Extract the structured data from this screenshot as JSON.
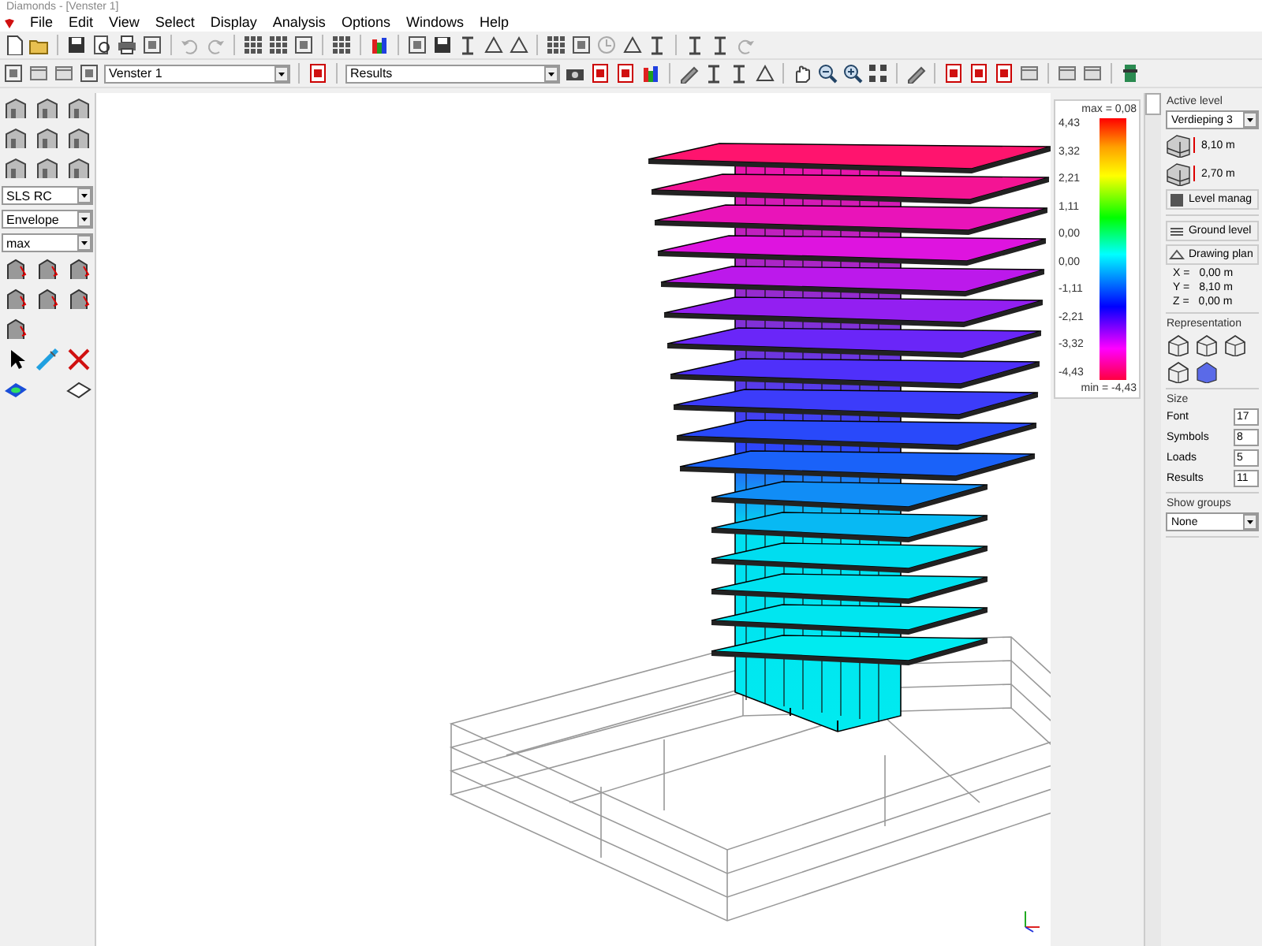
{
  "window": {
    "title": "Diamonds - [Venster 1]"
  },
  "menu": [
    "File",
    "Edit",
    "View",
    "Select",
    "Display",
    "Analysis",
    "Options",
    "Windows",
    "Help"
  ],
  "toolbar": {
    "window_select": "Venster 1",
    "view_select": "Results"
  },
  "left_panel": {
    "selects": [
      "SLS RC",
      "Envelope",
      "max"
    ]
  },
  "legend": {
    "max": "max = 0,08",
    "ticks": [
      "4,43",
      "3,32",
      "2,21",
      "1,11",
      "0,00",
      "0,00",
      "-1,11",
      "-2,21",
      "-3,32",
      "-4,43"
    ],
    "min": "min = -4,43"
  },
  "right_panel": {
    "active_level": {
      "title": "Active level",
      "level": "Verdieping 3",
      "elevation": "8,10 m",
      "height": "2,70 m",
      "manager": "Level manag"
    },
    "ground_level": "Ground level",
    "drawing_plane": "Drawing plan",
    "coords": [
      {
        "axis": "X =",
        "value": "0,00 m"
      },
      {
        "axis": "Y =",
        "value": "8,10 m"
      },
      {
        "axis": "Z =",
        "value": "0,00 m"
      }
    ],
    "representation": "Representation",
    "size": {
      "title": "Size",
      "fields": [
        {
          "label": "Font",
          "value": "17"
        },
        {
          "label": "Symbols",
          "value": "8"
        },
        {
          "label": "Loads",
          "value": "5"
        },
        {
          "label": "Results",
          "value": "11"
        }
      ]
    },
    "show_groups": {
      "title": "Show groups",
      "value": "None"
    }
  }
}
